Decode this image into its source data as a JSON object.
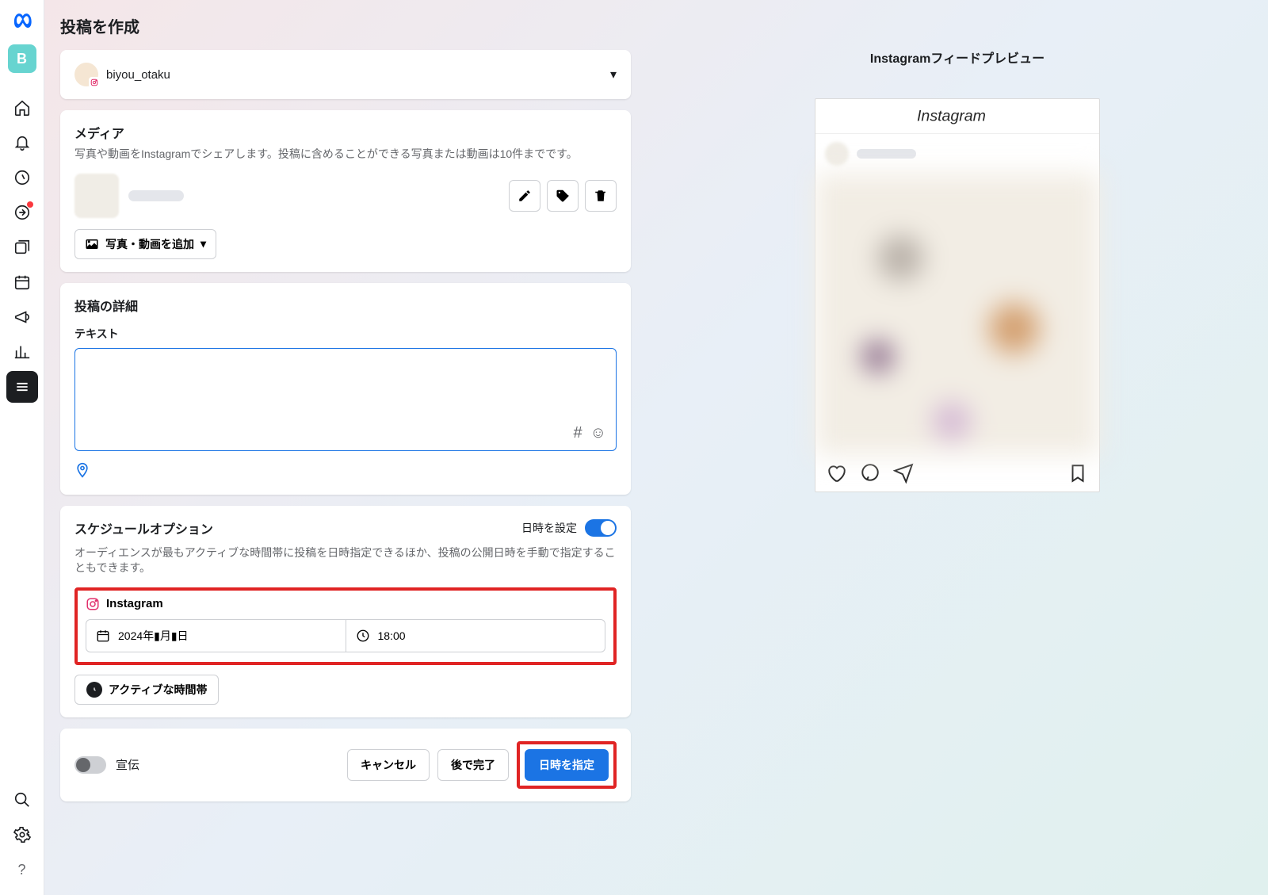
{
  "page": {
    "title": "投稿を作成"
  },
  "sidebar": {
    "avatar_letter": "B"
  },
  "account": {
    "name": "biyou_otaku"
  },
  "media": {
    "title": "メディア",
    "desc": "写真や動画をInstagramでシェアします。投稿に含めることができる写真または動画は10件までです。",
    "add_button": "写真・動画を追加"
  },
  "details": {
    "title": "投稿の詳細",
    "text_label": "テキスト",
    "text_value": ""
  },
  "schedule": {
    "title": "スケジュールオプション",
    "toggle_label": "日時を設定",
    "desc": "オーディエンスが最もアクティブな時間帯に投稿を日時指定できるほか、投稿の公開日時を手動で指定することもできます。",
    "platform": "Instagram",
    "date_value": "2024年▮月▮日",
    "time_value": "18:00",
    "active_time_button": "アクティブな時間帯"
  },
  "footer": {
    "promo_label": "宣伝",
    "cancel": "キャンセル",
    "later": "後で完了",
    "schedule_button": "日時を指定"
  },
  "preview": {
    "title": "Instagramフィードプレビュー",
    "brand": "Instagram"
  }
}
